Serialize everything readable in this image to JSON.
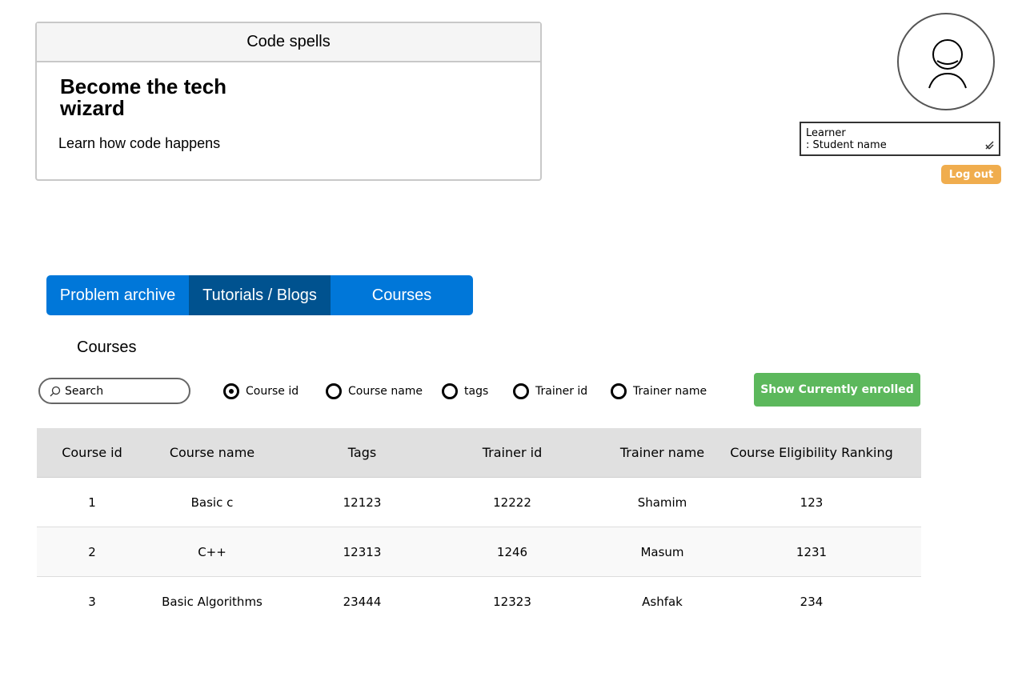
{
  "header_card": {
    "title": "Code spells",
    "heading": "Become the tech wizard",
    "subheading": "Learn how code happens"
  },
  "profile": {
    "avatar_icon": "user-avatar-icon",
    "learner_line1": "Learner",
    "learner_line2": ": Student name",
    "logout_label": "Log out"
  },
  "nav": {
    "tabs": [
      {
        "label": "Problem archive"
      },
      {
        "label": "Tutorials / Blogs"
      },
      {
        "label": "Courses"
      }
    ]
  },
  "section_title": "Courses",
  "search": {
    "placeholder": "Search",
    "icon": "search-icon"
  },
  "filters": [
    {
      "label": "Course id",
      "selected": true
    },
    {
      "label": "Course name",
      "selected": false
    },
    {
      "label": "tags",
      "selected": false
    },
    {
      "label": "Trainer id",
      "selected": false
    },
    {
      "label": "Trainer name",
      "selected": false
    }
  ],
  "enrolled_button": "Show Currently enrolled",
  "table": {
    "headers": [
      "Course id",
      "Course name",
      "Tags",
      "Trainer id",
      "Trainer name",
      "Course Eligibility Ranking"
    ],
    "rows": [
      [
        "1",
        "Basic c",
        "12123",
        "12222",
        "Shamim",
        "123"
      ],
      [
        "2",
        "C++",
        "12313",
        "1246",
        "Masum",
        "1231"
      ],
      [
        "3",
        "Basic Algorithms",
        "23444",
        "12323",
        "Ashfak",
        "234"
      ]
    ]
  },
  "colors": {
    "nav_blue": "#0077d9",
    "nav_active": "#00528f",
    "logout_orange": "#f0ad4e",
    "enrolled_green": "#5cb85c"
  }
}
